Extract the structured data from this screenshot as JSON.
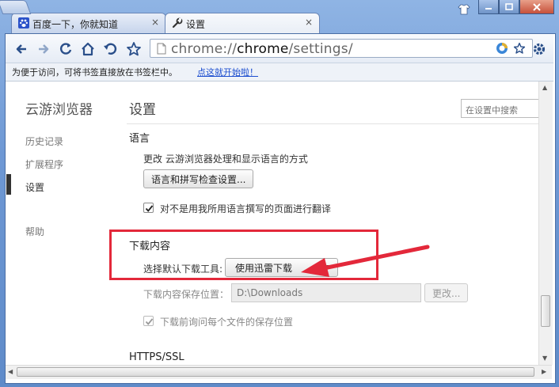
{
  "tabs": [
    {
      "label": "百度一下，你就知道",
      "close": "×"
    },
    {
      "label": "设置",
      "close": "×"
    }
  ],
  "url": {
    "scheme": "chrome://",
    "host": "chrome",
    "path": "/settings/"
  },
  "bookmark_bar": {
    "text": "为便于访问，可将书签直接放在书签栏中。",
    "link": "点这就开始啦！"
  },
  "sidebar": {
    "brand": "云游浏览器",
    "items": [
      {
        "label": "历史记录"
      },
      {
        "label": "扩展程序"
      },
      {
        "label": "设置"
      },
      {
        "label": "帮助"
      }
    ]
  },
  "main": {
    "title": "设置",
    "search_placeholder": "在设置中搜索",
    "language": {
      "title": "语言",
      "desc": "更改 云游浏览器处理和显示语言的方式",
      "button": "语言和拼写检查设置...",
      "translate_check": "对不是用我所用语言撰写的页面进行翻译"
    },
    "downloads": {
      "title": "下载内容",
      "tool_label": "选择默认下载工具:",
      "tool_value": "使用迅雷下载",
      "location_label": "下载内容保存位置：",
      "location_value": "D:\\Downloads",
      "change_button": "更改...",
      "ask_check": "下载前询问每个文件的保存位置"
    },
    "https": {
      "title": "HTTPS/SSL"
    }
  },
  "colors": {
    "annotation": "#e3283a",
    "link": "#1a4ccf",
    "frame": "#6e98d4"
  }
}
